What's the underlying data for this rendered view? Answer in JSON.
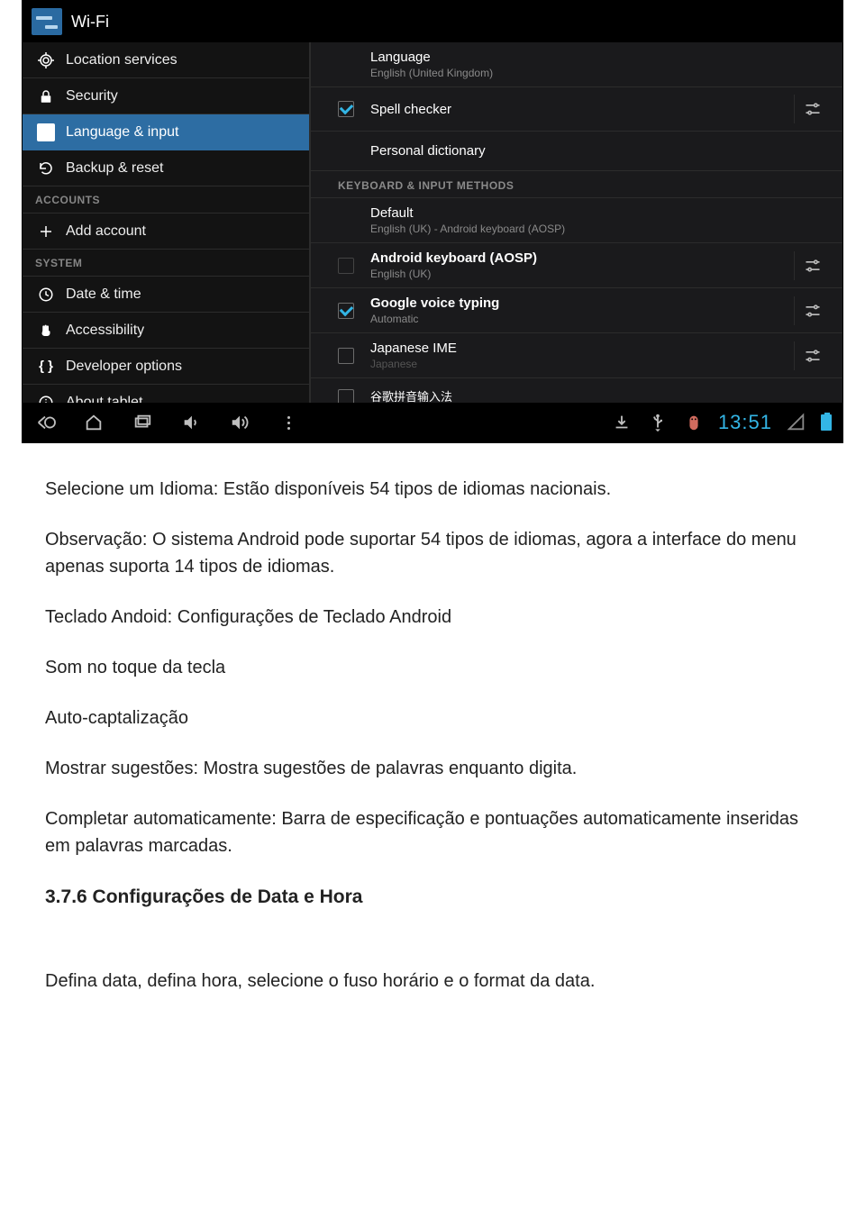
{
  "screenshot": {
    "wifi_label": "Wi-Fi",
    "sidebar": {
      "items": [
        {
          "id": "location",
          "icon": "reticle",
          "label": "Location services",
          "name": "sidebar-item-location"
        },
        {
          "id": "security",
          "icon": "lock",
          "label": "Security",
          "name": "sidebar-item-security"
        },
        {
          "id": "language",
          "icon": "A",
          "label": "Language & input",
          "name": "sidebar-item-language"
        },
        {
          "id": "backup",
          "icon": "backup",
          "label": "Backup & reset",
          "name": "sidebar-item-backup"
        }
      ],
      "accounts_header": "ACCOUNTS",
      "add_account": "Add account",
      "system_header": "SYSTEM",
      "system_items": [
        {
          "id": "datetime",
          "icon": "clock",
          "label": "Date & time",
          "name": "sidebar-item-datetime"
        },
        {
          "id": "accessibility",
          "icon": "hand",
          "label": "Accessibility",
          "name": "sidebar-item-accessibility"
        },
        {
          "id": "developer",
          "icon": "braces",
          "label": "Developer options",
          "name": "sidebar-item-developer"
        },
        {
          "id": "about",
          "icon": "info",
          "label": "About tablet",
          "name": "sidebar-item-about"
        }
      ]
    },
    "right": {
      "language_title": "Language",
      "language_sub": "English (United Kingdom)",
      "spell_checker": "Spell checker",
      "personal_dictionary": "Personal dictionary",
      "keyboard_header": "KEYBOARD & INPUT METHODS",
      "default_title": "Default",
      "default_sub": "English (UK)  -  Android keyboard (AOSP)",
      "android_kbd_title": "Android keyboard (AOSP)",
      "android_kbd_sub": "English (UK)",
      "google_voice_title": "Google voice typing",
      "google_voice_sub": "Automatic",
      "japanese_title": "Japanese IME",
      "japanese_sub": "Japanese",
      "partial_row": "谷歌拼音输入法"
    },
    "clock": "13:51"
  },
  "doc": {
    "p1": "Selecione um Idioma: Estão disponíveis 54 tipos de idiomas nacionais.",
    "p2": "Observação: O sistema Android pode suportar 54 tipos de idiomas, agora a interface do menu apenas suporta 14 tipos de idiomas.",
    "p3": "Teclado Andoid: Configurações de Teclado Android",
    "p4": "Som no toque da tecla",
    "p5": "Auto-captalização",
    "p6": "Mostrar sugestões: Mostra sugestões de palavras enquanto digita.",
    "p7": "Completar automaticamente: Barra de especificação e pontuações automaticamente inseridas em palavras marcadas.",
    "h3": "3.7.6  Configurações de Data e Hora",
    "p8": "Defina data, defina hora, selecione o fuso horário e o format da data."
  }
}
